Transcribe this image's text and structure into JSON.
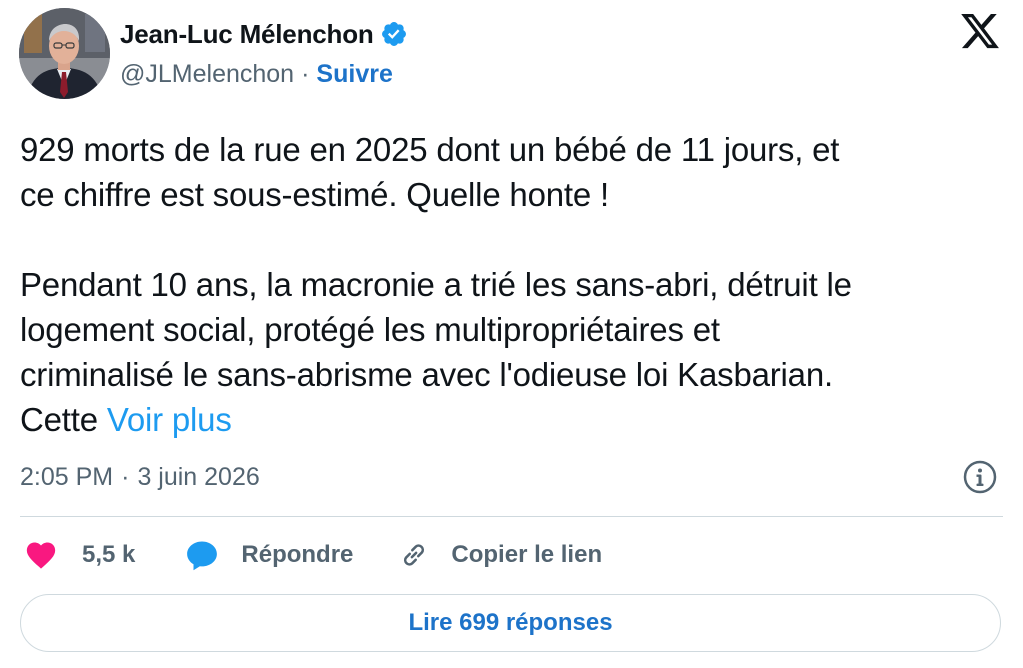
{
  "author": {
    "display_name": "Jean-Luc Mélenchon",
    "handle": "@JLMelenchon",
    "separator": "·",
    "follow_label": "Suivre",
    "verified": true
  },
  "tweet": {
    "paragraph_1": "929 morts de la rue en 2025 dont un bébé de 11 jours, et\nce chiffre est sous-estimé. Quelle honte !",
    "paragraph_2": "Pendant 10 ans, la macronie a trié les sans-abri, détruit le\nlogement social, protégé les multipropriétaires et\ncriminalisé le sans-abrisme avec l'odieuse loi Kasbarian.\nCette ",
    "see_more_label": "Voir plus"
  },
  "meta": {
    "time": "2:05 PM",
    "separator": "·",
    "date": "3 juin 2026"
  },
  "actions": {
    "like_count": "5,5 k",
    "reply_label": "Répondre",
    "copy_link_label": "Copier le lien"
  },
  "footer": {
    "read_replies_label": "Lire 699 réponses"
  },
  "icons": {
    "platform": "x-logo-icon",
    "verified": "verified-badge-icon",
    "info": "info-icon",
    "like": "heart-icon",
    "reply": "speech-bubble-icon",
    "copy": "link-icon"
  },
  "colors": {
    "accent_link": "#1d9bf0",
    "follow_blue": "#1d73c9",
    "heart": "#f91880",
    "reply_bubble": "#1d9bf0",
    "secondary_text": "#536471",
    "verified_badge": "#1d9bf0"
  }
}
